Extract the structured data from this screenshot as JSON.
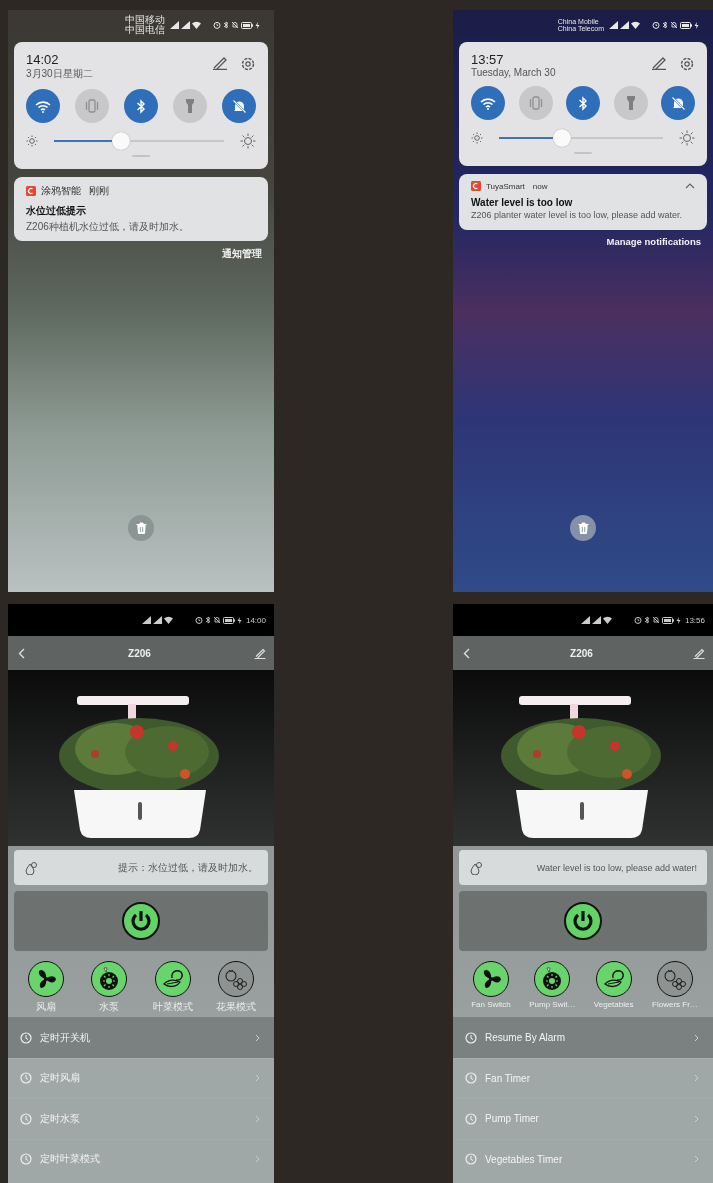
{
  "notification_screens": [
    {
      "status_bar": {
        "carriers": [
          "中国移动",
          "中国电信"
        ]
      },
      "quick_panel": {
        "time": "14:02",
        "date": "3月30日星期二",
        "toggles": [
          {
            "kind": "wifi",
            "on": true
          },
          {
            "kind": "vibrate",
            "on": false
          },
          {
            "kind": "bluetooth",
            "on": true
          },
          {
            "kind": "flashlight",
            "on": false
          },
          {
            "kind": "silent",
            "on": true
          }
        ],
        "brightness": {
          "level": 0.39
        }
      },
      "notification": {
        "app": "涂鸦智能",
        "when": "刚刚",
        "title": "水位过低提示",
        "body": "Z206种植机水位过低，请及时加水。",
        "collapsible": false
      },
      "manage_link": "通知管理"
    },
    {
      "status_bar": {
        "carriers": [
          "China Mobile",
          "China Telecom"
        ]
      },
      "quick_panel": {
        "time": "13:57",
        "date": "Tuesday, March 30",
        "toggles": [
          {
            "kind": "wifi",
            "on": true
          },
          {
            "kind": "vibrate",
            "on": false
          },
          {
            "kind": "bluetooth",
            "on": true
          },
          {
            "kind": "flashlight",
            "on": false
          },
          {
            "kind": "silent",
            "on": true
          }
        ],
        "brightness": {
          "level": 0.38
        }
      },
      "notification": {
        "app": "TuyaSmart",
        "when": "now",
        "title": "Water level is too low",
        "body": "Z206 planter water level is too low, please add water.",
        "collapsible": true
      },
      "manage_link": "Manage notifications"
    }
  ],
  "app_screens": [
    {
      "status_bar": {
        "time": "14:00"
      },
      "title": "Z206",
      "alert": "提示：水位过低，请及时加水。",
      "power": {
        "on": true
      },
      "modes": [
        {
          "kind": "fan",
          "label": "风扇",
          "on": true
        },
        {
          "kind": "pump",
          "label": "水泵",
          "on": true
        },
        {
          "kind": "vegetables",
          "label": "叶菜模式",
          "on": true
        },
        {
          "kind": "flowers",
          "label": "花果模式",
          "on": false
        }
      ],
      "timers": [
        {
          "label": "定时开关机",
          "selected": true
        },
        {
          "label": "定时风扇",
          "selected": false
        },
        {
          "label": "定时水泵",
          "selected": false
        },
        {
          "label": "定时叶菜模式",
          "selected": false
        }
      ]
    },
    {
      "status_bar": {
        "time": "13:56"
      },
      "title": "Z206",
      "alert": "Water level is too low, please add water!",
      "power": {
        "on": true
      },
      "modes": [
        {
          "kind": "fan",
          "label": "Fan Switch",
          "on": true
        },
        {
          "kind": "pump",
          "label": "Pump Swit…",
          "on": true
        },
        {
          "kind": "vegetables",
          "label": "Vegetables",
          "on": true
        },
        {
          "kind": "flowers",
          "label": "Flowers Fr…",
          "on": false
        }
      ],
      "timers": [
        {
          "label": "Resume By Alarm",
          "selected": true
        },
        {
          "label": "Fan Timer",
          "selected": false
        },
        {
          "label": "Pump Timer",
          "selected": false
        },
        {
          "label": "Vegetables Timer",
          "selected": false
        }
      ]
    }
  ]
}
